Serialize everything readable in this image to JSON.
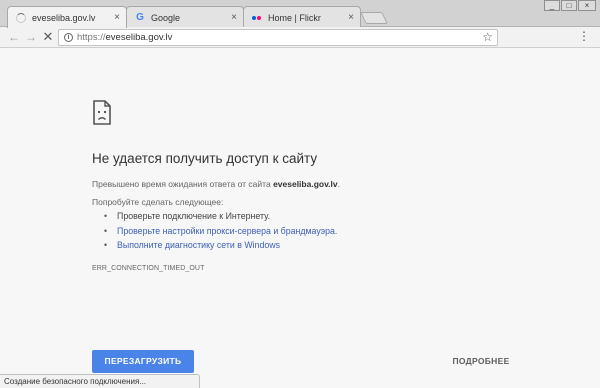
{
  "tabs": [
    {
      "title": "eveseliba.gov.lv",
      "favicon": "loading-spinner-icon",
      "close": "×"
    },
    {
      "title": "Google",
      "favicon": "google-icon",
      "favicon_text": "G",
      "close": "×"
    },
    {
      "title": "Home | Flickr",
      "favicon": "flickr-icon",
      "close": "×"
    }
  ],
  "window_controls": {
    "minimize": "_",
    "maximize": "□",
    "close": "×"
  },
  "toolbar": {
    "back": "←",
    "forward": "→",
    "stop": "✕",
    "info_icon": "i",
    "url_scheme": "https://",
    "url_host": "eveseliba.gov.lv",
    "star": "☆",
    "menu": "⋮"
  },
  "error_page": {
    "icon": "sad-page-icon",
    "heading": "Не удается получить доступ к сайту",
    "timeout_prefix": "Превышено время ожидания ответа от сайта ",
    "timeout_host": "eveseliba.gov.lv",
    "timeout_suffix": ".",
    "try_label": "Попробуйте сделать следующее:",
    "suggestions": [
      {
        "text": "Проверьте подключение к Интернету."
      },
      {
        "text": "Проверьте настройки прокси-сервера и брандмауэра."
      },
      {
        "text": "Выполните диагностику сети в Windows"
      }
    ],
    "error_code": "ERR_CONNECTION_TIMED_OUT",
    "reload_button": "ПЕРЕЗАГРУЗИТЬ",
    "details_button": "ПОДРОБНЕЕ"
  },
  "status_bar": {
    "text": "Создание безопасного подключения..."
  },
  "colors": {
    "accent": "#4a84e8",
    "link": "#3c5fb5",
    "flickr_pink": "#ff0084",
    "flickr_blue": "#0063dc"
  }
}
